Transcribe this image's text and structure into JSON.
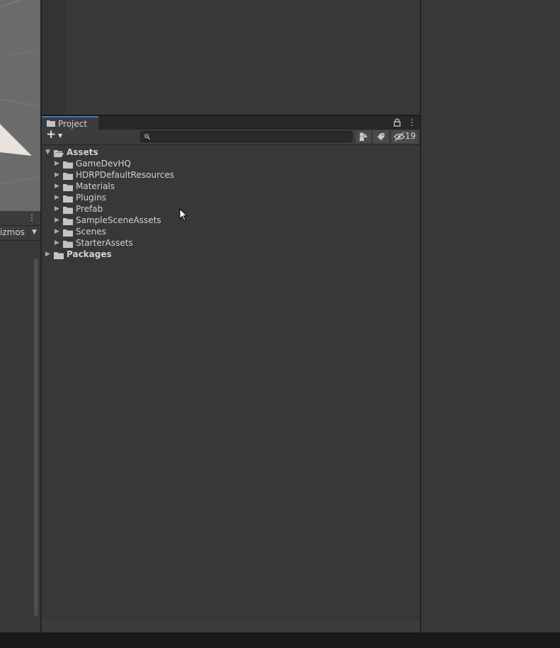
{
  "scene": {
    "gizmos_label": "izmos"
  },
  "project": {
    "tab_label": "Project",
    "search_placeholder": "",
    "hidden_packages_count": "19",
    "tree": [
      {
        "label": "Assets",
        "level": 0,
        "expanded": true,
        "bold": true
      },
      {
        "label": "GameDevHQ",
        "level": 1,
        "expanded": false,
        "bold": false
      },
      {
        "label": "HDRPDefaultResources",
        "level": 1,
        "expanded": false,
        "bold": false
      },
      {
        "label": "Materials",
        "level": 1,
        "expanded": false,
        "bold": false
      },
      {
        "label": "Plugins",
        "level": 1,
        "expanded": false,
        "bold": false
      },
      {
        "label": "Prefab",
        "level": 1,
        "expanded": false,
        "bold": false
      },
      {
        "label": "SampleSceneAssets",
        "level": 1,
        "expanded": false,
        "bold": false
      },
      {
        "label": "Scenes",
        "level": 1,
        "expanded": false,
        "bold": false
      },
      {
        "label": "StarterAssets",
        "level": 1,
        "expanded": false,
        "bold": false
      },
      {
        "label": "Packages",
        "level": 0,
        "expanded": false,
        "bold": true
      }
    ]
  },
  "icons": {
    "folder": "folder-icon",
    "folder_open": "folder-open-icon",
    "lock": "lock-icon",
    "search": "search-icon",
    "more": "kebab-menu-icon",
    "eye": "eye-slash-icon"
  },
  "colors": {
    "panel": "#383838",
    "toolbar": "#3c3c3c",
    "tab_accent": "#3a79bb",
    "text": "#d2d2d2"
  }
}
